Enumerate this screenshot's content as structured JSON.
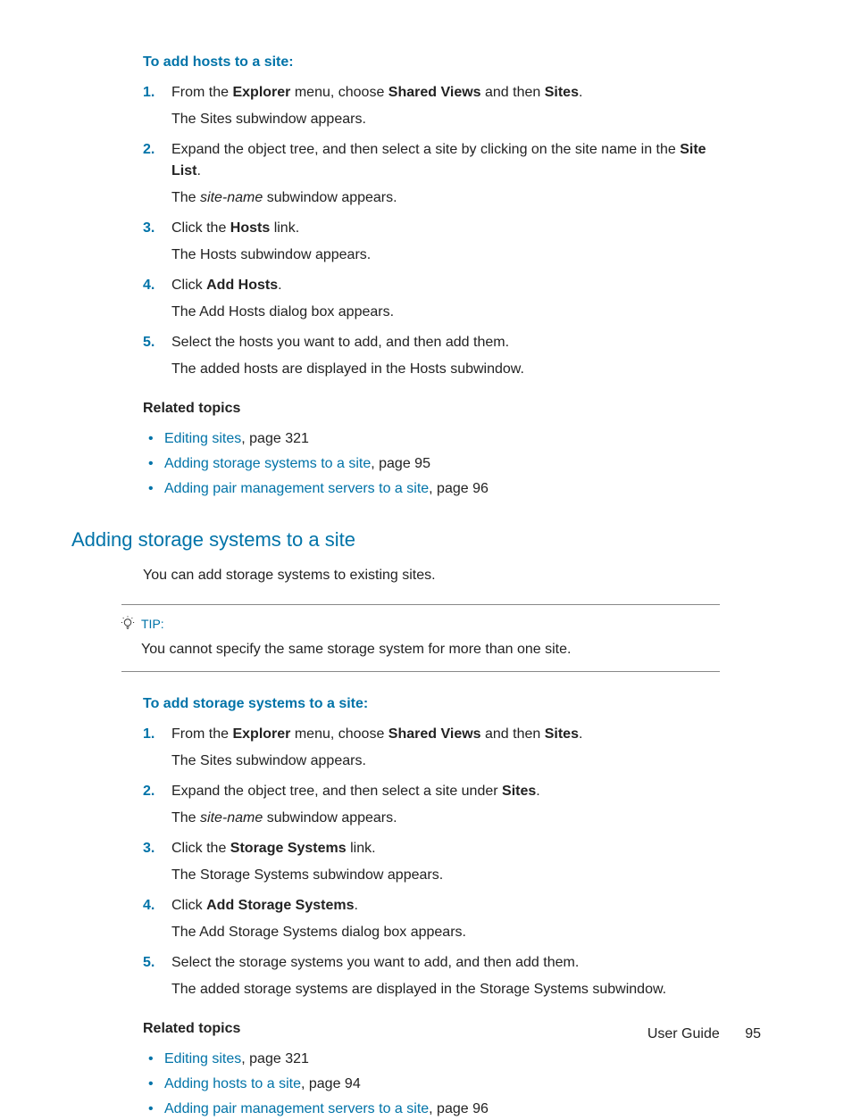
{
  "procA": {
    "title": "To add hosts to a site:",
    "steps": [
      {
        "num": "1.",
        "pre": "From the ",
        "b1": "Explorer",
        "mid": " menu, choose ",
        "b2": "Shared Views",
        "mid2": " and then ",
        "b3": "Sites",
        "post": ".",
        "result": "The Sites subwindow appears."
      },
      {
        "num": "2.",
        "pre": "Expand the object tree, and then select a site by clicking on the site name in the ",
        "b1": "Site List",
        "post": ".",
        "result_pre": "The ",
        "result_em": "site-name",
        "result_post": " subwindow appears."
      },
      {
        "num": "3.",
        "pre": "Click the ",
        "b1": "Hosts",
        "post": " link.",
        "result": "The Hosts subwindow appears."
      },
      {
        "num": "4.",
        "pre": "Click ",
        "b1": "Add Hosts",
        "post": ".",
        "result": "The Add Hosts dialog box appears."
      },
      {
        "num": "5.",
        "line": "Select the hosts you want to add, and then add them.",
        "result": "The added hosts are displayed in the Hosts subwindow."
      }
    ]
  },
  "relatedA": {
    "title": "Related topics",
    "items": [
      {
        "link": "Editing sites",
        "rest": ", page 321"
      },
      {
        "link": "Adding storage systems to a site",
        "rest": ", page 95"
      },
      {
        "link": "Adding pair management servers to a site",
        "rest": ", page 96"
      }
    ]
  },
  "sectionB": {
    "title": "Adding storage systems to a site",
    "intro": "You can add storage systems to existing sites."
  },
  "tip": {
    "label": "TIP:",
    "text": "You cannot specify the same storage system for more than one site."
  },
  "procB": {
    "title": "To add storage systems to a site:",
    "steps": [
      {
        "num": "1.",
        "pre": "From the ",
        "b1": "Explorer",
        "mid": " menu, choose ",
        "b2": "Shared Views",
        "mid2": " and then ",
        "b3": "Sites",
        "post": ".",
        "result": "The Sites subwindow appears."
      },
      {
        "num": "2.",
        "pre": "Expand the object tree, and then select a site under ",
        "b1": "Sites",
        "post": ".",
        "result_pre": "The ",
        "result_em": "site-name",
        "result_post": " subwindow appears."
      },
      {
        "num": "3.",
        "pre": "Click the ",
        "b1": "Storage Systems",
        "post": " link.",
        "result": "The Storage Systems subwindow appears."
      },
      {
        "num": "4.",
        "pre": "Click ",
        "b1": "Add Storage Systems",
        "post": ".",
        "result": "The Add Storage Systems dialog box appears."
      },
      {
        "num": "5.",
        "line": "Select the storage systems you want to add, and then add them.",
        "result": "The added storage systems are displayed in the Storage Systems subwindow."
      }
    ]
  },
  "relatedB": {
    "title": "Related topics",
    "items": [
      {
        "link": "Editing sites",
        "rest": ", page 321"
      },
      {
        "link": "Adding hosts to a site",
        "rest": ", page 94"
      },
      {
        "link": "Adding pair management servers to a site",
        "rest": ", page 96"
      }
    ]
  },
  "footer": {
    "doc": "User Guide",
    "page": "95"
  }
}
